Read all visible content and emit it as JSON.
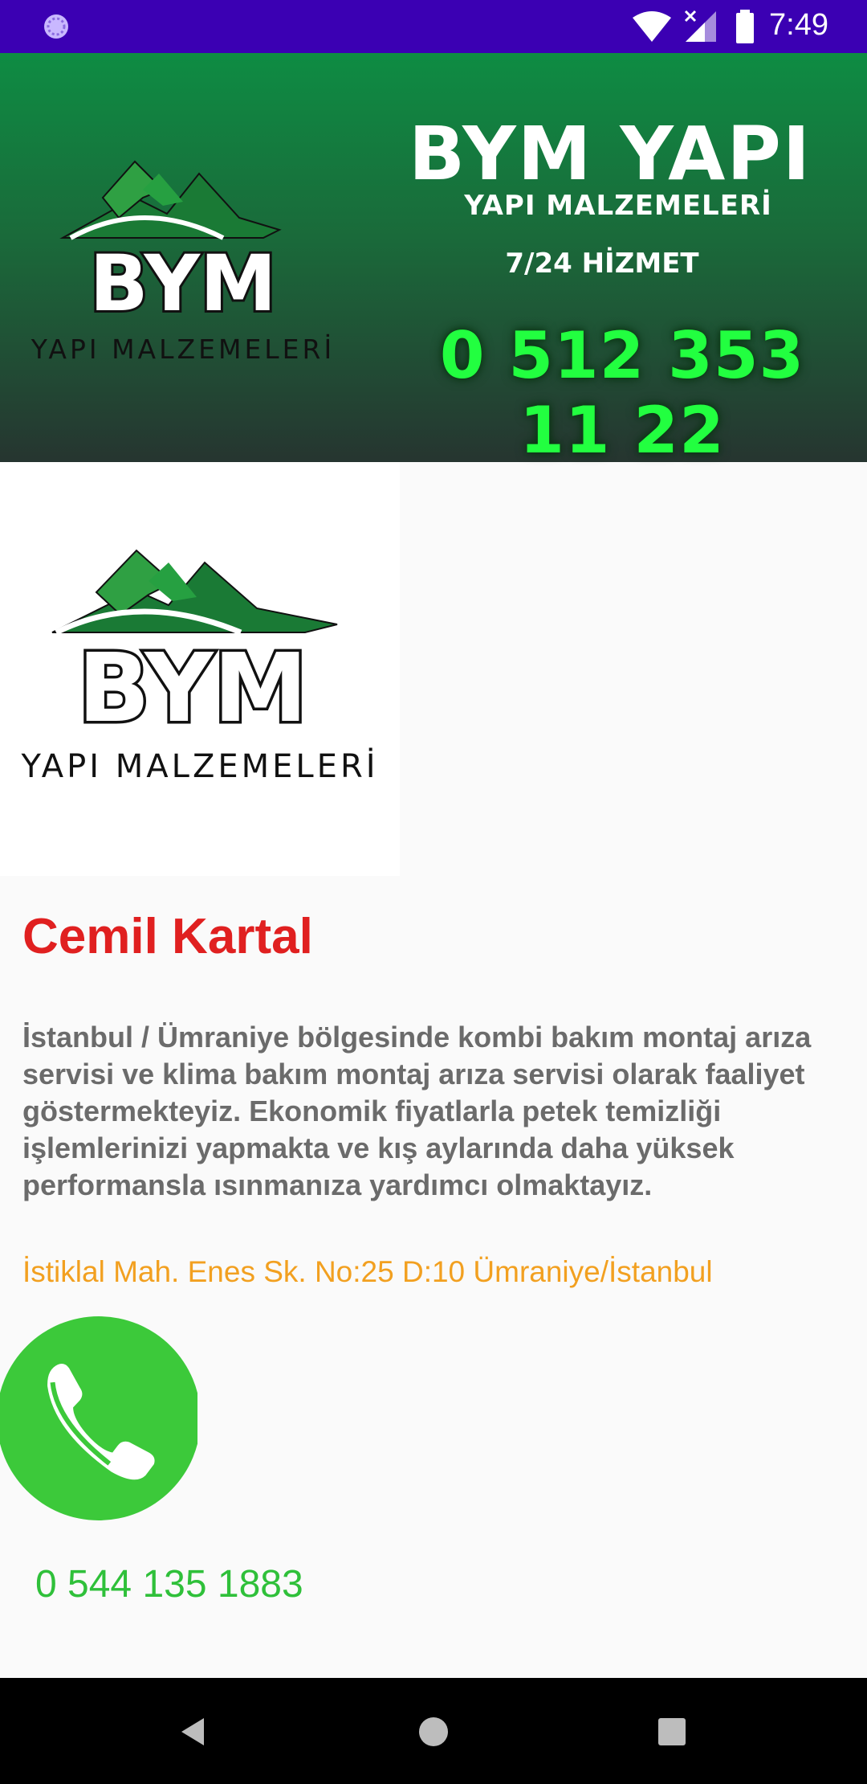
{
  "status_bar": {
    "time": "7:49",
    "bg_color": "#3b00b3",
    "icons": [
      "notification-dot-icon",
      "wifi-icon",
      "signal-icon",
      "battery-icon"
    ]
  },
  "banner": {
    "logo_main": "BYM",
    "logo_sub": "YAPI MALZEMELERİ",
    "title": "BYM YAPI",
    "subtitle": "YAPI MALZEMELERİ",
    "service": "7/24 HİZMET",
    "phone": "0 512 353 11 22",
    "colors": {
      "top": "#0e8c43",
      "bottom": "#263530",
      "phone": "#22ff40"
    }
  },
  "logo_card": {
    "logo_main": "BYM",
    "logo_sub": "YAPI MALZEMELERİ"
  },
  "contact": {
    "name": "Cemil Kartal",
    "description": "İstanbul / Ümraniye bölgesinde kombi bakım montaj arıza servisi ve klima bakım montaj arıza servisi olarak faaliyet göstermekteyiz. Ekonomik fiyatlarla petek temizliği işlemlerinizi yapmakta ve kış aylarında daha yüksek performansla ısınmanıza yardımcı olmaktayız.",
    "address": "İstiklal Mah. Enes Sk. No:25 D:10 Ümraniye/İstanbul",
    "phone": "0 544 135 1883",
    "colors": {
      "name": "#e02020",
      "address": "#f2a020",
      "phone": "#2fc03a",
      "call_button": "#3cc93a"
    }
  },
  "nav_bar": {
    "buttons": [
      "back-icon",
      "home-icon",
      "recents-icon"
    ]
  }
}
